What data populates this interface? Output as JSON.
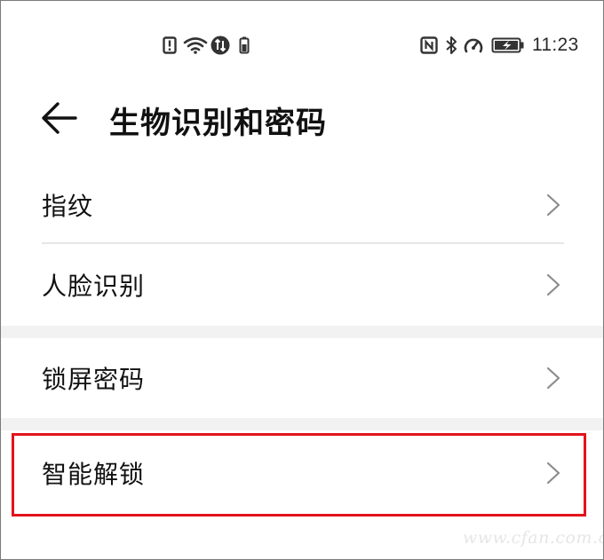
{
  "status_bar": {
    "time": "11:23",
    "left_icons": [
      "alert-icon",
      "wifi-icon",
      "data-transfer-icon",
      "sim-icon"
    ],
    "right_icons": [
      "nfc-icon",
      "bluetooth-icon",
      "speed-icon",
      "battery-icon"
    ]
  },
  "header": {
    "title": "生物识别和密码"
  },
  "list": {
    "items": [
      {
        "label": "指纹"
      },
      {
        "label": "人脸识别"
      },
      {
        "label": "锁屏密码"
      },
      {
        "label": "智能解锁",
        "highlighted": true
      }
    ]
  },
  "colors": {
    "highlight": "#e3131b",
    "section_gap": "#f2f2f2",
    "divider": "#e6e6e6"
  },
  "watermark": {
    "text": "www.cfan.com.cn"
  }
}
